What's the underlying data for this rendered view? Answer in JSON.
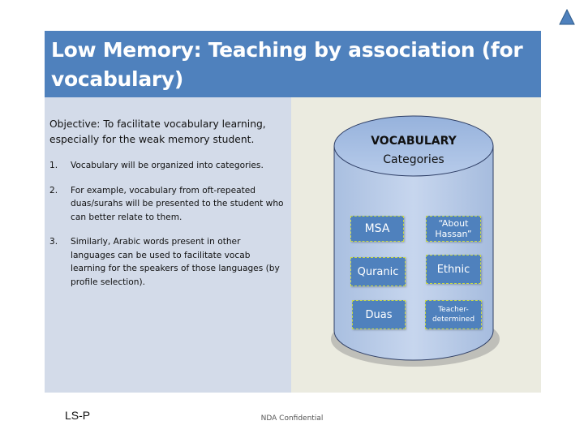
{
  "slide": {
    "title": "Low Memory:  Teaching by association (for vocabulary)",
    "objective": "Objective:  To facilitate vocabulary learning, especially for the weak memory student.",
    "points": [
      {
        "num": "1.",
        "text": "Vocabulary will be organized into categories."
      },
      {
        "num": "2.",
        "text": "For example, vocabulary from oft-repeated duas/surahs will be presented to the student who can better relate to them."
      },
      {
        "num": "3.",
        "text": "Similarly, Arabic words present in other languages can be used to facilitate vocab learning for the speakers of those languages (by profile selection)."
      }
    ]
  },
  "diagram": {
    "title": "VOCABULARY",
    "subtitle": "Categories",
    "categories": {
      "msa": "MSA",
      "about_hassan": "“About Hassan”",
      "quranic": "Quranic",
      "ethnic": "Ethnic",
      "duas": "Duas",
      "teacher": "Teacher-determined"
    }
  },
  "footer": {
    "left": "LS-P",
    "center": "NDA Confidential"
  },
  "colors": {
    "title_bar": "#4f81bd",
    "left_panel": "#d3dbe9",
    "right_panel": "#ebebe0",
    "category_box": "#4f81bd",
    "category_border": "#c8d84a",
    "nav_triangle": "#4f81bd"
  },
  "icons": {
    "nav": "triangle-up-icon"
  }
}
